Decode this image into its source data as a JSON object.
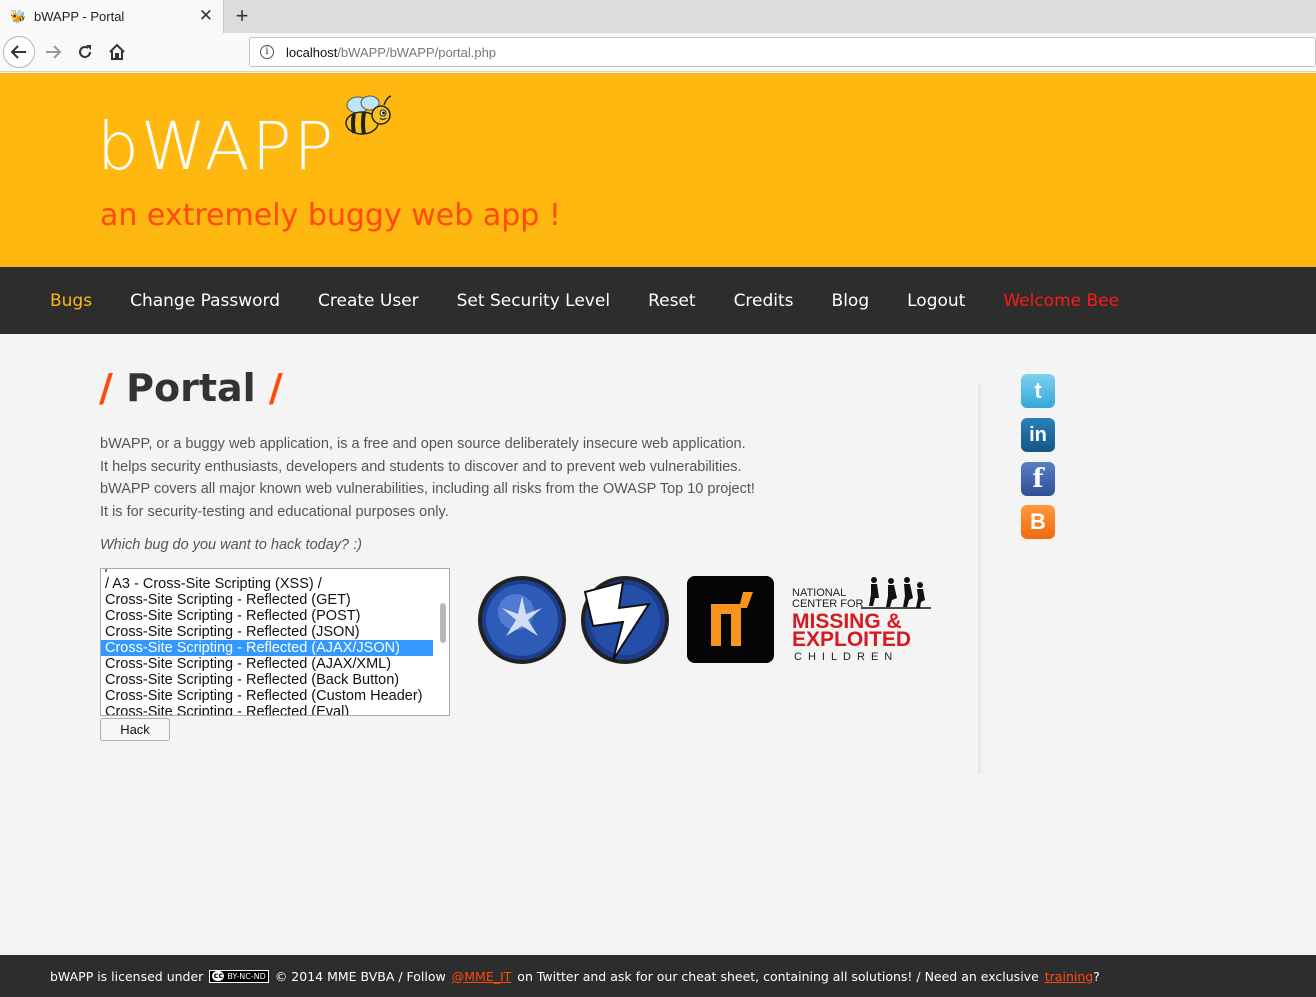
{
  "browser": {
    "tab_title": "bWAPP - Portal",
    "tab_close": "✕",
    "new_tab": "+",
    "url_host": "localhost",
    "url_path": "/bWAPP/bWAPP/portal.php"
  },
  "header": {
    "logo": "bWAPP",
    "tagline": "an extremely buggy web app !"
  },
  "menu": {
    "items": [
      "Bugs",
      "Change Password",
      "Create User",
      "Set Security Level",
      "Reset",
      "Credits",
      "Blog",
      "Logout",
      "Welcome Bee"
    ]
  },
  "page": {
    "title": "Portal",
    "slash": "/",
    "intro_lines": [
      "bWAPP, or a buggy web application, is a free and open source deliberately insecure web application.",
      "It helps security enthusiasts, developers and students to discover and to prevent web vulnerabilities.",
      "bWAPP covers all major known web vulnerabilities, including all risks from the OWASP Top 10 project!",
      "It is for security-testing and educational purposes only."
    ],
    "question": "Which bug do you want to hack today? :)",
    "bug_options": [
      "/",
      "/ A3 - Cross-Site Scripting (XSS) /",
      "Cross-Site Scripting - Reflected (GET)",
      "Cross-Site Scripting - Reflected (POST)",
      "Cross-Site Scripting - Reflected (JSON)",
      "Cross-Site Scripting - Reflected (AJAX/JSON)",
      "Cross-Site Scripting - Reflected (AJAX/XML)",
      "Cross-Site Scripting - Reflected (Back Button)",
      "Cross-Site Scripting - Reflected (Custom Header)",
      "Cross-Site Scripting - Reflected (Eval)"
    ],
    "selected_option": "Cross-Site Scripting - Reflected (AJAX/JSON)",
    "hack_button": "Hack"
  },
  "sponsors": {
    "ncmec_line1": "NATIONAL",
    "ncmec_line2": "CENTER FOR",
    "ncmec_line3": "MISSING &",
    "ncmec_line4": "EXPLOITED",
    "ncmec_line5": "CHILDREN"
  },
  "social": {
    "twitter": "t",
    "linkedin": "in",
    "facebook": "f",
    "blogger": "B"
  },
  "footer": {
    "text1": "bWAPP is licensed under",
    "cc_label": "BY-NC-ND",
    "cc_symbol": "cc",
    "text2": "© 2014 MME BVBA / Follow",
    "twitter_link": "@MME_IT",
    "text3": "on Twitter and ask for our cheat sheet, containing all solutions! / Need an exclusive",
    "training_link": "training",
    "text4": "?"
  },
  "colors": {
    "header_bg": "#ffb80f",
    "accent": "#ff4a0c",
    "menu_bg": "#2d2d2d",
    "welcome": "#ff1a1a"
  }
}
